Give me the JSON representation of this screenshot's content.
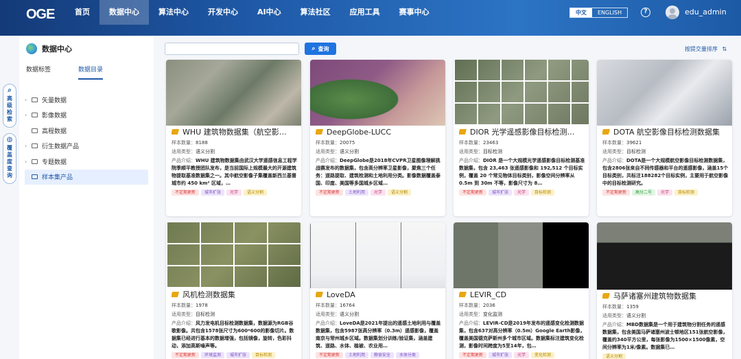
{
  "header": {
    "logo": "OGE",
    "nav": [
      "首页",
      "数据中心",
      "算法中心",
      "开发中心",
      "AI中心",
      "算法社区",
      "应用工具",
      "赛事中心"
    ],
    "active_nav": 1,
    "lang": {
      "zh": "中文",
      "en": "ENGLISH"
    },
    "help_icon": "?",
    "username": "edu_admin"
  },
  "left_strip": [
    {
      "icon": "search-icon",
      "label": "高级检索",
      "glyph": "⌕"
    },
    {
      "icon": "globe-icon",
      "label": "覆盖度查询",
      "glyph": "◍"
    }
  ],
  "panel": {
    "title": "数据中心",
    "tabs": [
      "数据标签",
      "数据目录"
    ],
    "active_tab": 1,
    "tree": [
      {
        "label": "矢量数据",
        "expandable": true
      },
      {
        "label": "影像数据",
        "expandable": true
      },
      {
        "label": "高程数据",
        "expandable": false
      },
      {
        "label": "衍生数据产品",
        "expandable": true
      },
      {
        "label": "专题数据",
        "expandable": true
      },
      {
        "label": "样本集产品",
        "expandable": false,
        "selected": true
      }
    ]
  },
  "toolbar": {
    "search_placeholder": "",
    "query_label": "查询",
    "sort_label": "按提交量排序"
  },
  "labels": {
    "count": "样本数量：",
    "type": "适用类型：",
    "desc": "产品介绍："
  },
  "cards": [
    {
      "title": "WHU 建筑物数据集（航空影…",
      "count": "8188",
      "type": "语义分割",
      "desc": "WHU 建筑物数据集由武汉大学遥感信息工程学院季顺平教授团队发布，是当前国际上规模最大的开源建筑物提取基准数据集之一。其中航空影像子集覆盖新西兰基督城市约 450 km² 区域，…",
      "tags": [
        [
          "不定期更新",
          "red"
        ],
        [
          "城市扩张",
          "pur"
        ],
        [
          "光学",
          "pink"
        ],
        [
          "语义分割",
          "yel"
        ]
      ]
    },
    {
      "title": "DeepGlobe-LUCC",
      "count": "20075",
      "type": "语义分割",
      "desc": "DeepGlobe是2018年CVPR卫星图像理解挑战赛发布的数据集，包含高分辨率卫星影像，聚焦三个任务：道路提取、建筑检测和土地利用分类。影像数据覆盖泰国、印度、美国等多国城乡区域…",
      "tags": [
        [
          "不定期更新",
          "red"
        ],
        [
          "土地利用",
          "pur"
        ],
        [
          "光学",
          "pink"
        ],
        [
          "语义分割",
          "yel"
        ]
      ]
    },
    {
      "title": "DIOR 光学遥感影像目标检测…",
      "count": "23463",
      "type": "目标检测",
      "desc": "DIOR 是一个大规模光学遥感影像目标检测基准数据集，包含 23,463 张遥感影像和 192,512 个目标实例，覆盖 20 个常见物体目标类别，影像空间分辨率从 0.5m 到 30m 不等，影像尺寸为 8…",
      "tags": [
        [
          "不定期更新",
          "red"
        ],
        [
          "城市扩张",
          "pur"
        ],
        [
          "光学",
          "pink"
        ],
        [
          "目标检测",
          "yel"
        ]
      ]
    },
    {
      "title": "DOTA 航空影像目标检测数据集",
      "count": "39621",
      "type": "目标检测",
      "desc": "DOTA是一个大规模航空影像目标检测数据集，包含2806张来自不同传感器和平台的遥感影像，涵盖15个目标类别，共标注188282个目标实例，主要用于航空影像中的目标检测研究。",
      "tags": [
        [
          "不定期更新",
          "red"
        ],
        [
          "高分二号",
          "grn"
        ],
        [
          "光学",
          "pink"
        ],
        [
          "目标检测",
          "yel"
        ]
      ]
    },
    {
      "title": "风机检测数据集",
      "count": "1978",
      "type": "目标检测",
      "desc": "风力发电机目标检测数据集，数据源为RGB谷歌影像。共包含1578张尺寸为600*600的影像切片。数据集已经进行基本的数据增强，包括镜像，旋转，色彩抖动，添加高斯噪声等。",
      "tags": [
        [
          "不定期更新",
          "red"
        ],
        [
          "环境监测",
          "pur"
        ],
        [
          "城市扩张",
          "pur"
        ],
        [
          "目标检测",
          "yel"
        ]
      ]
    },
    {
      "title": "LoveDA",
      "count": "16764",
      "type": "语义分割",
      "desc": "LoveDA是2021年提出的遥感土地利用与覆盖数据集，包含5987张高分辨率（0.3m）遥感影像，覆盖南京与常州城乡区域。数据集划分训练/验证集，涵盖建筑、道路、水体、植被、农业用…",
      "tags": [
        [
          "不定期更新",
          "red"
        ],
        [
          "土地利用",
          "pur"
        ],
        [
          "粮食安全",
          "pur"
        ],
        [
          "水体分类",
          "pur"
        ]
      ]
    },
    {
      "title": "LEVIR_CD",
      "count": "2036",
      "type": "变化监测",
      "desc": "LEVIR-CD是2019年发布的遥感变化检测数据集，包含637对高分辨率（0.5m）Google Earth影像，覆盖美国德克萨斯州多个城市区域。数据集标注建筑变化检测，影像时间跨度为5至14年，包…",
      "tags": [
        [
          "不定期更新",
          "red"
        ],
        [
          "城市扩张",
          "pur"
        ],
        [
          "光学",
          "pink"
        ],
        [
          "变化检测",
          "yel"
        ]
      ]
    },
    {
      "title": "马萨诸塞州建筑物数据集",
      "count": "1359",
      "type": "语义分割",
      "desc": "MBD数据集是一个用于建筑物分割任务的遥感数据集，包含美国马萨诸塞州波士顿地区151张航空影像，覆盖约340平方公里，每张影像为1500×1500像素，空间分辨率为1米/像素。数据集已…",
      "tags": [
        [
          "语义分割",
          "yel"
        ]
      ]
    }
  ]
}
